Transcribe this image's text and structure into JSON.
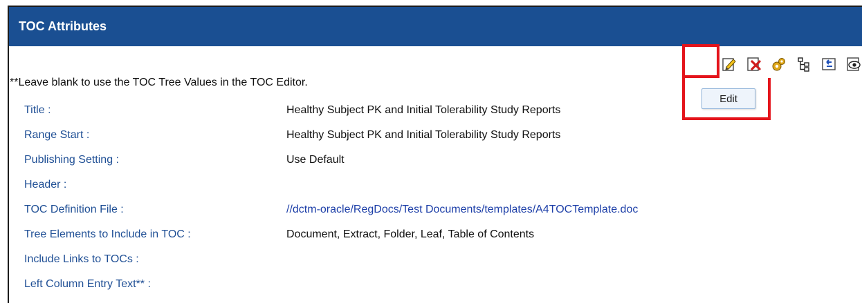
{
  "panel": {
    "title": "TOC Attributes"
  },
  "toolbar": {
    "icons": [
      "edit-icon",
      "delete-icon",
      "settings-gears-icon",
      "tree-structure-icon",
      "export-icon",
      "preview-icon"
    ],
    "tooltip": "Edit"
  },
  "note": "**Leave blank to use the TOC Tree Values in the TOC Editor.",
  "fields": [
    {
      "label": "Title :",
      "value": "Healthy Subject PK and Initial Tolerability Study Reports"
    },
    {
      "label": "Range Start :",
      "value": "Healthy Subject PK and Initial Tolerability Study Reports"
    },
    {
      "label": "Publishing Setting :",
      "value": "Use Default"
    },
    {
      "label": "Header :",
      "value": ""
    },
    {
      "label": "TOC Definition File :",
      "value": "//dctm-oracle/RegDocs/Test Documents/templates/A4TOCTemplate.doc"
    },
    {
      "label": "Tree Elements to Include in TOC :",
      "value": "Document, Extract, Folder, Leaf, Table of Contents"
    },
    {
      "label": "Include Links to TOCs :",
      "value": ""
    },
    {
      "label": "Left Column Entry Text** :",
      "value": ""
    }
  ],
  "colors": {
    "header_bg": "#1a4f92",
    "label": "#1f4f95",
    "link": "#1d3fa8",
    "highlight": "#e4141b"
  }
}
